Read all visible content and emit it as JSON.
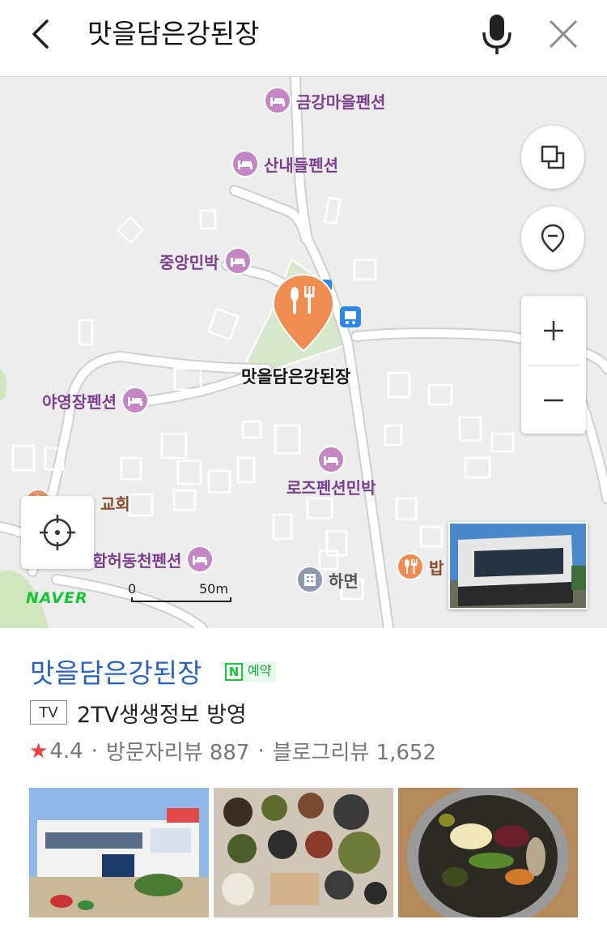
{
  "header": {
    "query": "맛을담은강된장",
    "back_icon": "chevron-left-icon",
    "mic_icon": "microphone-icon",
    "close_icon": "close-icon"
  },
  "map": {
    "pois": [
      {
        "name": "금강마을펜션",
        "icon": "lodging-icon"
      },
      {
        "name": "산내들펜션",
        "icon": "lodging-icon"
      },
      {
        "name": "중앙민박",
        "icon": "lodging-icon"
      },
      {
        "name": "야영장펜션",
        "icon": "lodging-icon"
      },
      {
        "name": "로즈펜션민박",
        "icon": "lodging-icon"
      },
      {
        "name": "교회",
        "icon": "church-icon"
      },
      {
        "name": "함허동천펜션",
        "icon": "lodging-icon"
      },
      {
        "name": "하면",
        "icon": "building-icon"
      },
      {
        "name": "밥",
        "icon": "restaurant-icon"
      }
    ],
    "selected_marker_label": "맛을담은강된장",
    "scale_zero": "0",
    "scale_distance": "50m",
    "logo": "NAVER",
    "colors": {
      "marker": "#ef8c52",
      "poi_lodging": "#c586c6",
      "naver_green": "#19c437"
    }
  },
  "place": {
    "title": "맛을담은강된장",
    "badge_n": "N",
    "badge_label": "예약",
    "tv_tag": "TV",
    "tv_text": "2TV생생정보 방영",
    "rating": "4.4",
    "sep1": "·",
    "visitor_reviews": "방문자리뷰 887",
    "sep2": "·",
    "blog_reviews": "블로그리뷰 1,652"
  }
}
